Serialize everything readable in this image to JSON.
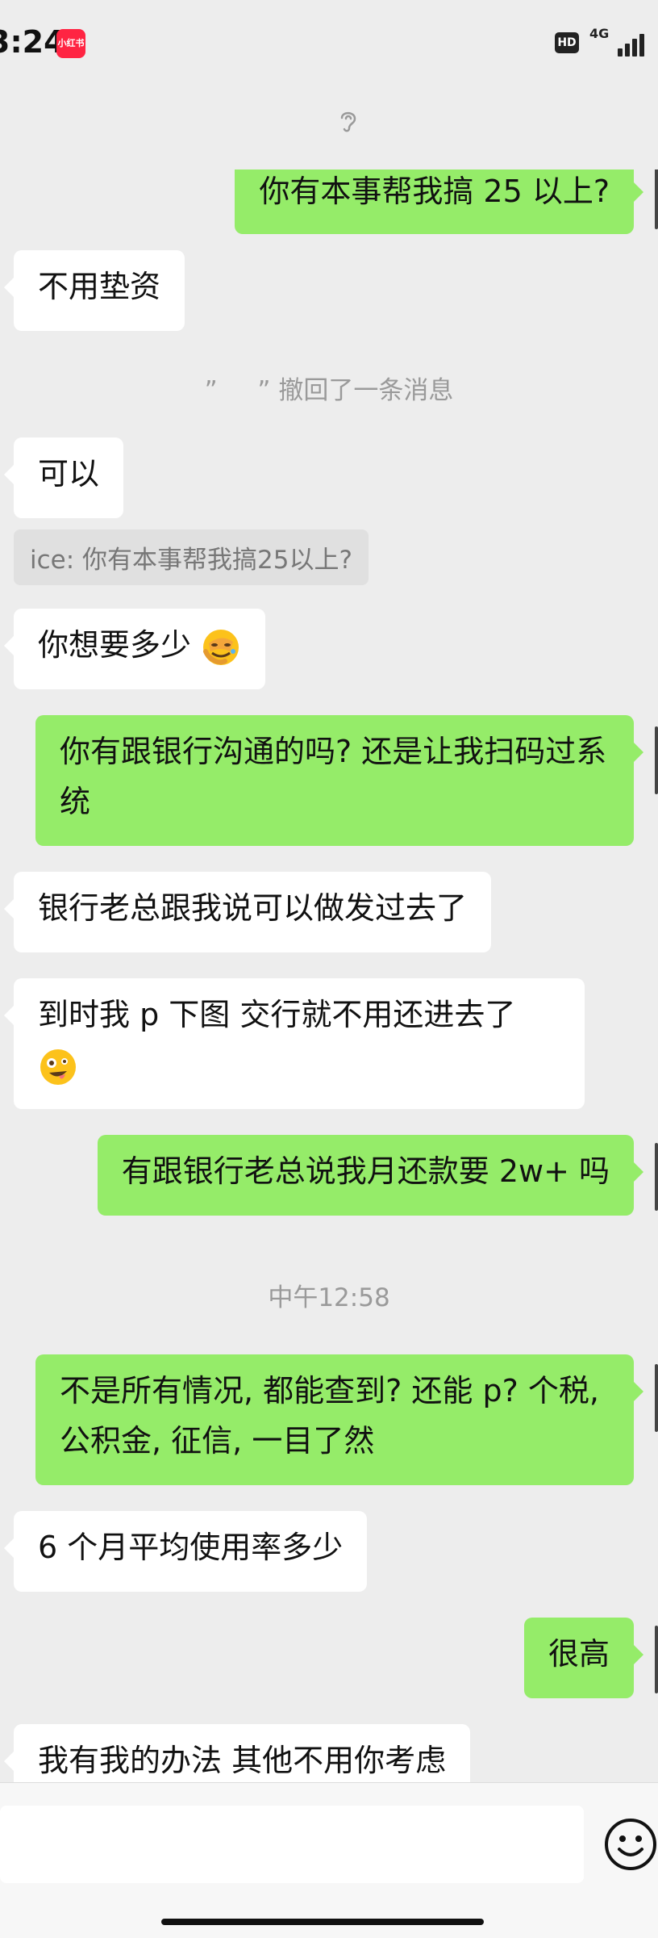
{
  "status_bar": {
    "time": "3:24",
    "app_badge": "小红书",
    "hd": "HD",
    "network": "4G"
  },
  "messages": {
    "m1": "你有本事帮我搞 25 以上?",
    "m2": "不用垫资",
    "recall_quote": "”",
    "recall_text": "撤回了一条消息",
    "m3": "可以",
    "quote": "ice: 你有本事帮我搞25以上?",
    "m4": "你想要多少",
    "m5": "你有跟银行沟通的吗? 还是让我扫码过系统",
    "m6": "银行老总跟我说可以做发过去了",
    "m7": "到时我 p 下图  交行就不用还进去了",
    "m8": "有跟银行老总说我月还款要 2w+ 吗",
    "timestamp": "中午12:58",
    "m9": "不是所有情况, 都能查到? 还能 p? 个税, 公积金, 征信, 一目了然",
    "m10": "6 个月平均使用率多少",
    "m11": "很高",
    "m12": "我有我的办法 其他不用你考虑"
  },
  "colors": {
    "chat_bg": "#ededed",
    "sent_bubble": "#95ec69",
    "received_bubble": "#ffffff",
    "system_text": "#9a9a9a"
  },
  "icons": [
    "ear-icon",
    "facepalm-emoji",
    "zany-face-emoji",
    "smile-icon"
  ]
}
